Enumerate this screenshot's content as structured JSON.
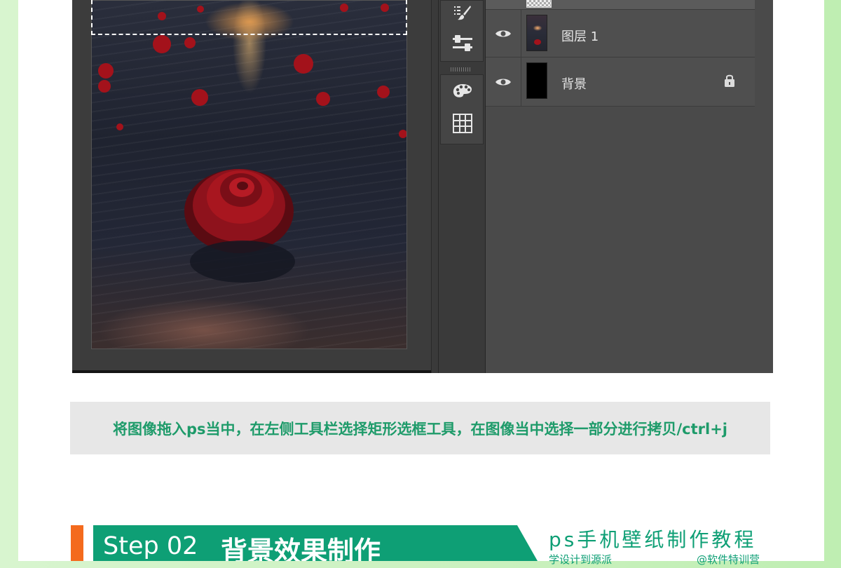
{
  "screenshot": {
    "layers": [
      {
        "name": "图层 1",
        "visible": true,
        "locked": false,
        "thumbnail": "rose-sea-photo"
      },
      {
        "name": "背景",
        "visible": true,
        "locked": true,
        "thumbnail": "black-fill"
      }
    ],
    "tools": [
      "brush-tool-icon",
      "adjustment-sliders-icon",
      "paint-palette-icon",
      "grid-table-icon"
    ]
  },
  "instruction": "将图像拖入ps当中，在左侧工具栏选择矩形选框工具，在图像当中选择一部分进行拷贝/ctrl+j",
  "step": {
    "number": "Step 02",
    "title": "背景效果制作"
  },
  "brand": {
    "title": "ps手机壁纸制作教程",
    "subtitle_left": "学设计到源派",
    "subtitle_right": "@软件特训营"
  },
  "colors": {
    "accent_green": "#0e9f75",
    "accent_orange": "#f46a1d",
    "instruction_text": "#1e9b6a"
  }
}
